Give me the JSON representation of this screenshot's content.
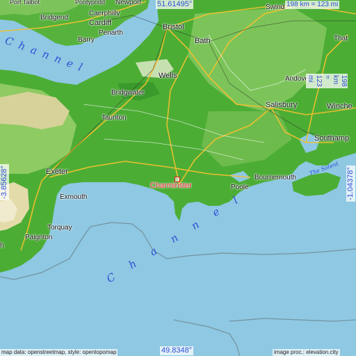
{
  "map": {
    "highlight_place": "Charminster",
    "colors": {
      "sea": "#8ec8e2",
      "low_land": "#3fa832",
      "mid_land": "#7cc45a",
      "high_land": "#d7d29a",
      "road_major": "#f2c12e",
      "accent": "#2d4fd6",
      "marker": "#e0202a"
    }
  },
  "coords": {
    "top_lat": "51.61495°",
    "bottom_lat": "49.8348°",
    "left_lon": "-3.85628°",
    "right_lon": "-1.04378°"
  },
  "scale": {
    "top": "198 km = 123 mi",
    "right": "198 km = 123 mi"
  },
  "sea_labels": {
    "bristol_channel": "Channel",
    "english_channel": "Channel",
    "solent": "The Solent"
  },
  "places": [
    {
      "id": "port-talbot",
      "name": "Port Talbot"
    },
    {
      "id": "pontypridd",
      "name": "Pontypridd"
    },
    {
      "id": "newport",
      "name": "Newport"
    },
    {
      "id": "bridgend",
      "name": "Bridgend"
    },
    {
      "id": "caerphilly",
      "name": "Caerphilly"
    },
    {
      "id": "cardiff",
      "name": "Cardiff"
    },
    {
      "id": "penarth",
      "name": "Penarth"
    },
    {
      "id": "barry",
      "name": "Barry"
    },
    {
      "id": "bristol",
      "name": "Bristol"
    },
    {
      "id": "swindon",
      "name": "Swind"
    },
    {
      "id": "bath",
      "name": "Bath"
    },
    {
      "id": "thatcham",
      "name": "That"
    },
    {
      "id": "wells",
      "name": "Wells"
    },
    {
      "id": "bridgwater",
      "name": "Bridgwater"
    },
    {
      "id": "andover",
      "name": "Andover"
    },
    {
      "id": "taunton",
      "name": "Taunton"
    },
    {
      "id": "salisbury",
      "name": "Salisbury"
    },
    {
      "id": "winchester",
      "name": "Winche"
    },
    {
      "id": "southampton",
      "name": "Southamp"
    },
    {
      "id": "exeter",
      "name": "Exeter"
    },
    {
      "id": "bournemouth",
      "name": "Bournemouth"
    },
    {
      "id": "poole",
      "name": "Poole"
    },
    {
      "id": "exmouth",
      "name": "Exmouth"
    },
    {
      "id": "torquay",
      "name": "Torquay"
    },
    {
      "id": "paignton",
      "name": "Paignton"
    },
    {
      "id": "plymouth-edge",
      "name": "h"
    }
  ],
  "footer": {
    "left": "map data: openstreetmap, style: opentopomap",
    "right": "image proc.: elevation.city"
  }
}
